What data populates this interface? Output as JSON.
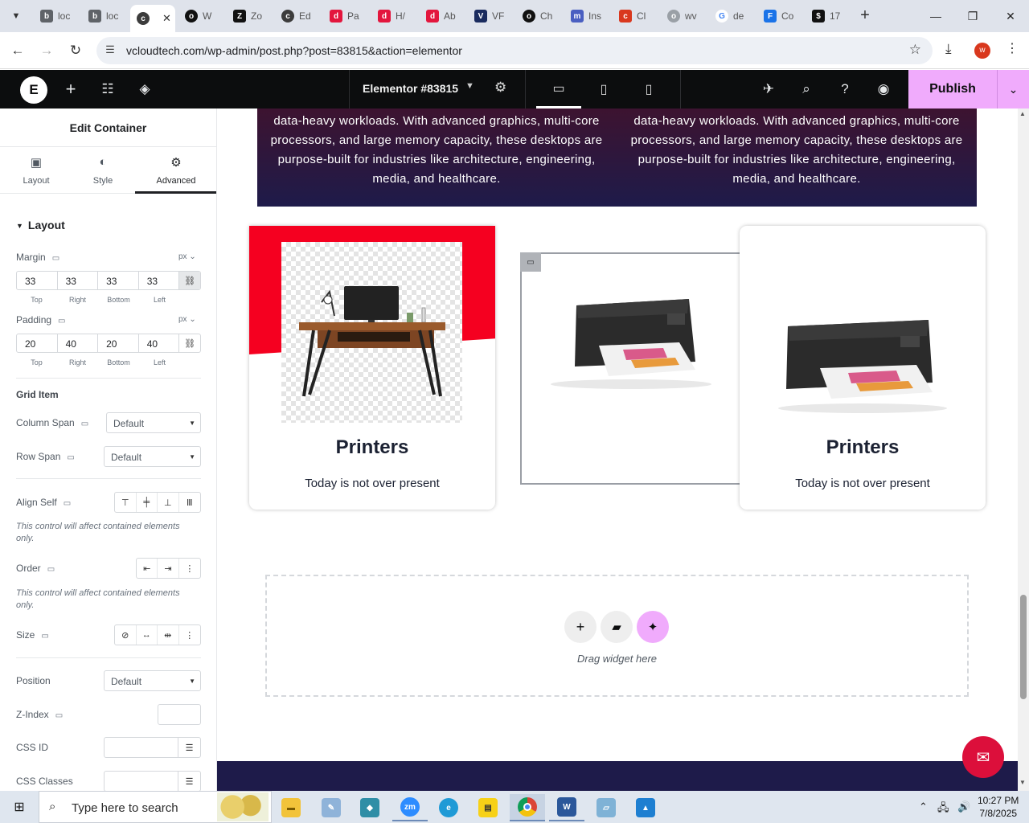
{
  "browser": {
    "tabs": [
      {
        "label": "loc",
        "fav": "b",
        "color": "#5f6368"
      },
      {
        "label": "loc",
        "fav": "b",
        "color": "#5f6368"
      },
      {
        "label": "",
        "fav": "c",
        "color": "#3c3c3c",
        "active": true
      },
      {
        "label": "W",
        "fav": "o",
        "color": "#111"
      },
      {
        "label": "Zo",
        "fav": "Z",
        "color": "#111"
      },
      {
        "label": "Ed",
        "fav": "c",
        "color": "#3c3c3c"
      },
      {
        "label": "Pa",
        "fav": "d",
        "color": "#e3163d"
      },
      {
        "label": "H/",
        "fav": "d",
        "color": "#e3163d"
      },
      {
        "label": "Ab",
        "fav": "d",
        "color": "#e3163d"
      },
      {
        "label": "VF",
        "fav": "V",
        "color": "#1a2b5e"
      },
      {
        "label": "Ch",
        "fav": "o",
        "color": "#111"
      },
      {
        "label": "Ins",
        "fav": "m",
        "color": "#4a5fc1"
      },
      {
        "label": "Cl",
        "fav": "c",
        "color": "#d9381e"
      },
      {
        "label": "wv",
        "fav": "o",
        "color": "#9aa0a6"
      },
      {
        "label": "de",
        "fav": "G",
        "color": "#4285f4"
      },
      {
        "label": "Co",
        "fav": "F",
        "color": "#1a73e8"
      },
      {
        "label": "17",
        "fav": "$",
        "color": "#111"
      }
    ],
    "close_tab_glyph": "✕",
    "new_tab_glyph": "+",
    "url": "vcloudtech.com/wp-admin/post.php?post=83815&action=elementor",
    "profile_initial": "w"
  },
  "elementor": {
    "logo": "E",
    "doc_title": "Elementor #83815",
    "publish_label": "Publish"
  },
  "panel": {
    "title": "Edit Container",
    "tabs": {
      "layout": "Layout",
      "style": "Style",
      "advanced": "Advanced"
    },
    "layout_section": "Layout",
    "margin": {
      "label": "Margin",
      "unit": "px",
      "values": [
        "33",
        "33",
        "33",
        "33"
      ],
      "sides": [
        "Top",
        "Right",
        "Bottom",
        "Left"
      ]
    },
    "padding": {
      "label": "Padding",
      "unit": "px",
      "values": [
        "20",
        "40",
        "20",
        "40"
      ],
      "sides": [
        "Top",
        "Right",
        "Bottom",
        "Left"
      ]
    },
    "grid_item": "Grid Item",
    "column_span": {
      "label": "Column Span",
      "value": "Default"
    },
    "row_span": {
      "label": "Row Span",
      "value": "Default"
    },
    "align_self": {
      "label": "Align Self"
    },
    "align_note": "This control will affect contained elements only.",
    "order": {
      "label": "Order"
    },
    "order_note": "This control will affect contained elements only.",
    "size": {
      "label": "Size"
    },
    "position": {
      "label": "Position",
      "value": "Default"
    },
    "z_index": {
      "label": "Z-Index",
      "value": ""
    },
    "css_id": {
      "label": "CSS ID",
      "value": ""
    },
    "css_classes": {
      "label": "CSS Classes",
      "value": ""
    }
  },
  "canvas": {
    "hero_left": "data-heavy workloads. With advanced graphics, multi-core processors, and large memory capacity, these desktops are purpose-built for industries like architecture, engineering, media, and healthcare.",
    "hero_right": "data-heavy workloads. With advanced graphics, multi-core processors, and large memory capacity, these desktops are purpose-built for industries like architecture, engineering, media, and healthcare.",
    "card1": {
      "title": "Printers",
      "subtitle": "Today is not over present"
    },
    "card3": {
      "title": "Printers",
      "subtitle": "Today is not over present"
    },
    "dropzone_text": "Drag widget here"
  },
  "taskbar": {
    "search_placeholder": "Type here to search",
    "time": "10:27 PM",
    "date": "7/8/2025"
  },
  "colors": {
    "accent_pink": "#f0abfc",
    "card_red": "#f50020",
    "hero_navy": "#1e1b4a",
    "chat_red": "#dc0f3b"
  }
}
